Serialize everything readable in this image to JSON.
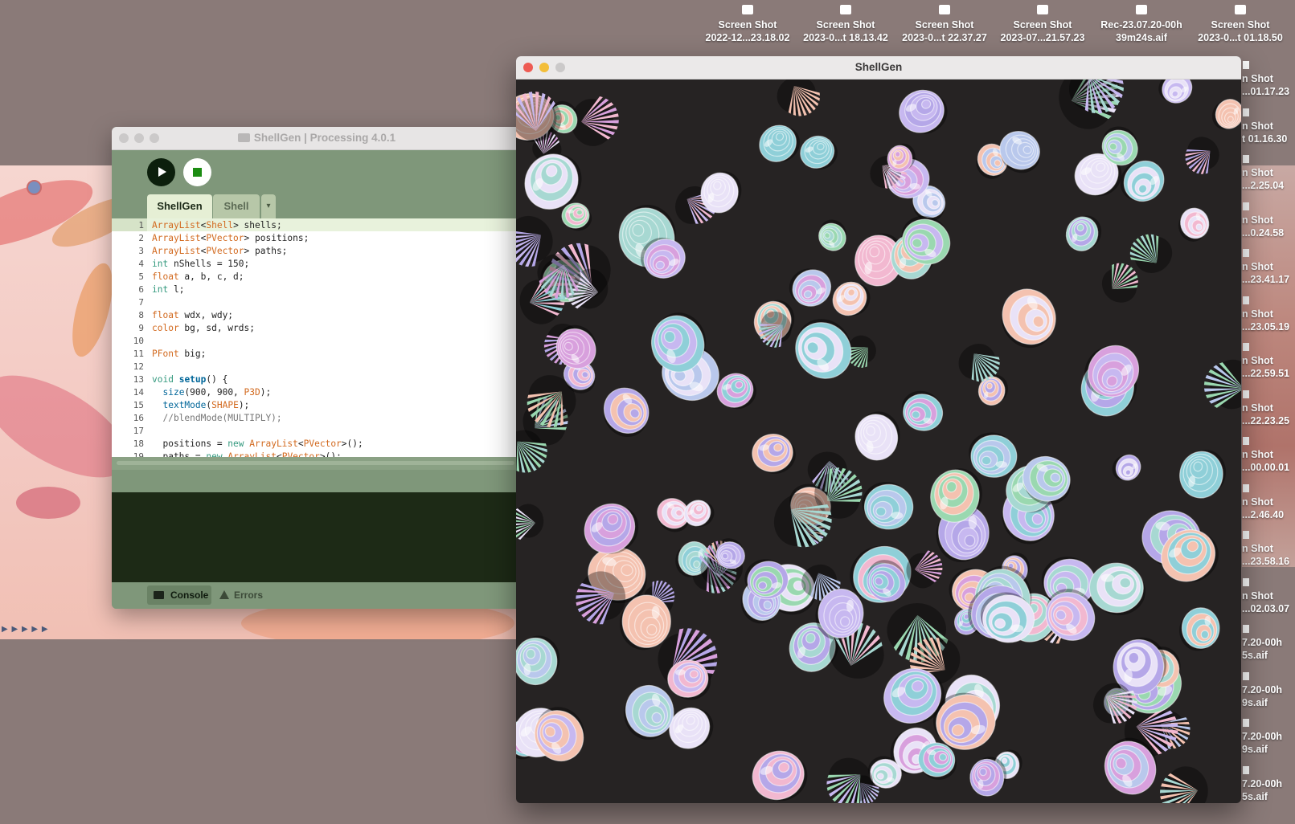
{
  "desktop": {
    "top_icons": [
      {
        "line1": "Screen Shot",
        "line2": "2022-12...23.18.02"
      },
      {
        "line1": "Screen Shot",
        "line2": "2023-0...t 18.13.42"
      },
      {
        "line1": "Screen Shot",
        "line2": "2023-0...t 22.37.27"
      },
      {
        "line1": "Screen Shot",
        "line2": "2023-07...21.57.23"
      },
      {
        "line1": "Rec-23.07.20-00h",
        "line2": "39m24s.aif"
      },
      {
        "line1": "Screen Shot",
        "line2": "2023-0...t 01.18.50"
      }
    ],
    "side_icons": [
      {
        "line1": "n Shot",
        "line2": "...01.17.23"
      },
      {
        "line1": "n Shot",
        "line2": "t 01.16.30"
      },
      {
        "line1": "n Shot",
        "line2": "...2.25.04"
      },
      {
        "line1": "n Shot",
        "line2": "...0.24.58"
      },
      {
        "line1": "n Shot",
        "line2": "...23.41.17"
      },
      {
        "line1": "n Shot",
        "line2": "...23.05.19"
      },
      {
        "line1": "n Shot",
        "line2": "...22.59.51"
      },
      {
        "line1": "n Shot",
        "line2": "...22.23.25"
      },
      {
        "line1": "n Shot",
        "line2": "...00.00.01"
      },
      {
        "line1": "n Shot",
        "line2": "...2.46.40"
      },
      {
        "line1": "n Shot",
        "line2": "...23.58.16"
      },
      {
        "line1": "n Shot",
        "line2": "...02.03.07"
      },
      {
        "line1": "7.20-00h",
        "line2": "5s.aif"
      },
      {
        "line1": "7.20-00h",
        "line2": "9s.aif"
      },
      {
        "line1": "7.20-00h",
        "line2": "9s.aif"
      },
      {
        "line1": "7.20-00h",
        "line2": "5s.aif"
      }
    ]
  },
  "ide": {
    "title": "ShellGen | Processing 4.0.1",
    "tabs": [
      {
        "label": "ShellGen"
      },
      {
        "label": "Shell"
      }
    ],
    "tab_menu_glyph": "▾",
    "code_lines": [
      {
        "n": "1",
        "segments": [
          [
            "cls",
            "ArrayList"
          ],
          [
            "",
            "<"
          ],
          [
            "cls",
            "Shell"
          ],
          [
            "",
            "> shells;"
          ]
        ]
      },
      {
        "n": "2",
        "segments": [
          [
            "cls",
            "ArrayList"
          ],
          [
            "",
            "<"
          ],
          [
            "cls",
            "PVector"
          ],
          [
            "",
            "> positions;"
          ]
        ]
      },
      {
        "n": "3",
        "segments": [
          [
            "cls",
            "ArrayList"
          ],
          [
            "",
            "<"
          ],
          [
            "cls",
            "PVector"
          ],
          [
            "",
            "> paths;"
          ]
        ]
      },
      {
        "n": "4",
        "segments": [
          [
            "kw2",
            "int"
          ],
          [
            "",
            " nShells = 150;"
          ]
        ]
      },
      {
        "n": "5",
        "segments": [
          [
            "kw",
            "float"
          ],
          [
            "",
            " a, b, c, d;"
          ]
        ]
      },
      {
        "n": "6",
        "segments": [
          [
            "kw2",
            "int"
          ],
          [
            "",
            " l;"
          ]
        ]
      },
      {
        "n": "7",
        "segments": []
      },
      {
        "n": "8",
        "segments": [
          [
            "kw",
            "float"
          ],
          [
            "",
            " wdx, wdy;"
          ]
        ]
      },
      {
        "n": "9",
        "segments": [
          [
            "kw",
            "color"
          ],
          [
            "",
            " bg, sd, wrds;"
          ]
        ]
      },
      {
        "n": "10",
        "segments": []
      },
      {
        "n": "11",
        "segments": [
          [
            "cls",
            "PFont"
          ],
          [
            "",
            " big;"
          ]
        ]
      },
      {
        "n": "12",
        "segments": []
      },
      {
        "n": "13",
        "segments": [
          [
            "kw2",
            "void"
          ],
          [
            "",
            " "
          ],
          [
            "fn",
            "setup"
          ],
          [
            "",
            "() {"
          ]
        ]
      },
      {
        "n": "14",
        "segments": [
          [
            "",
            "  "
          ],
          [
            "fn2",
            "size"
          ],
          [
            "",
            "(900, 900, "
          ],
          [
            "cls",
            "P3D"
          ],
          [
            "",
            ");"
          ]
        ]
      },
      {
        "n": "15",
        "segments": [
          [
            "",
            "  "
          ],
          [
            "fn2",
            "textMode"
          ],
          [
            "",
            "("
          ],
          [
            "cls",
            "SHAPE"
          ],
          [
            "",
            ");"
          ]
        ]
      },
      {
        "n": "16",
        "segments": [
          [
            "cm",
            "  //blendMode(MULTIPLY);"
          ]
        ]
      },
      {
        "n": "17",
        "segments": []
      },
      {
        "n": "18",
        "segments": [
          [
            "",
            "  positions = "
          ],
          [
            "kw2",
            "new"
          ],
          [
            "",
            " "
          ],
          [
            "cls",
            "ArrayList"
          ],
          [
            "",
            "<"
          ],
          [
            "cls",
            "PVector"
          ],
          [
            "",
            ">();"
          ]
        ]
      },
      {
        "n": "19",
        "segments": [
          [
            "",
            "  paths = "
          ],
          [
            "kw2",
            "new"
          ],
          [
            "",
            " "
          ],
          [
            "cls",
            "ArrayList"
          ],
          [
            "",
            "<"
          ],
          [
            "cls",
            "PVector"
          ],
          [
            "",
            ">();"
          ]
        ]
      }
    ],
    "console_tab": "Console",
    "errors_tab": "Errors"
  },
  "sketch": {
    "title": "ShellGen",
    "background": "#262323",
    "palette": [
      "#c7b8f0",
      "#a7d8d2",
      "#f2b8d0",
      "#b9c8ec",
      "#9ad8b0",
      "#d8a0dd",
      "#e9e2f7",
      "#8fcfd8",
      "#f4c2b0",
      "#b5a7e8"
    ],
    "shell_count": 150
  },
  "colors": {
    "desktop": "#8a7a78",
    "ide_accent": "#7f977a",
    "editor_highlight": "#e8f2dc",
    "traffic_red": "#ee5b53",
    "traffic_yellow": "#f3be39",
    "traffic_gray": "#cbc9c9"
  }
}
